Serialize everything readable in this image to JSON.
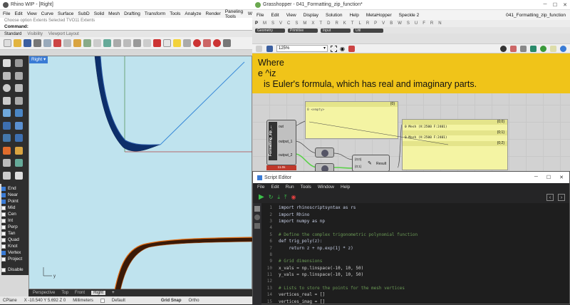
{
  "rhino": {
    "title": "Rhino WIP - [Right]",
    "menu": [
      "File",
      "Edit",
      "View",
      "Curve",
      "Surface",
      "SubD",
      "Solid",
      "Mesh",
      "Drafting",
      "Transform",
      "Tools",
      "Analyze",
      "Render",
      "Paneling Tools",
      "W"
    ],
    "cmd_history": "Choose option  Extents  Selected  TVO11  Extents",
    "command_label": "Command:",
    "toolbar_tabs": [
      "Standard",
      "Visibility",
      "Viewport Layout"
    ],
    "viewport_label": "Right",
    "viewport_tabs": [
      "Perspective",
      "Top",
      "Front",
      "Right"
    ],
    "osnaps": [
      {
        "label": "End",
        "on": true
      },
      {
        "label": "Near",
        "on": true
      },
      {
        "label": "Point",
        "on": true
      },
      {
        "label": "Mid",
        "on": false
      },
      {
        "label": "Cen",
        "on": false
      },
      {
        "label": "Int",
        "on": false
      },
      {
        "label": "Perp",
        "on": false
      },
      {
        "label": "Tan",
        "on": false
      },
      {
        "label": "Quad",
        "on": false
      },
      {
        "label": "Knot",
        "on": false
      },
      {
        "label": "Vertex",
        "on": true
      },
      {
        "label": "Project",
        "on": false
      },
      {
        "label": "Disable",
        "on": false
      }
    ],
    "status": {
      "cplane": "CPlane",
      "coords": "X -10.540 Y 5.692 Z 0",
      "units": "Millimeters",
      "layer": "Default",
      "grid_snap": "Grid Snap",
      "ortho": "Ortho"
    }
  },
  "grasshopper": {
    "title": "Grasshopper - 041_Formatting_zip_function*",
    "menu": [
      "File",
      "Edit",
      "View",
      "Display",
      "Solution",
      "Help",
      "MetaHopper",
      "Speckle 2"
    ],
    "doc_name": "041_Formatting_zip_function",
    "tab_letters": [
      "P",
      "M",
      "S",
      "V",
      "C",
      "S",
      "M",
      "X",
      "T",
      "D",
      "R",
      "K",
      "T",
      "L",
      "R",
      "P",
      "V",
      "B",
      "W",
      "S",
      "U",
      "F",
      "R",
      "N"
    ],
    "subtabs": [
      "Geometry",
      "Primitive",
      "Input",
      "Util"
    ],
    "zoom": "125%",
    "note_lines": [
      "Where",
      "e ^iz",
      "is Euler's formula, which has real and imaginary parts."
    ],
    "component_name": "Formatting_zip_...",
    "component_outputs": [
      "out",
      "output_1",
      "output_2"
    ],
    "component_time": "11.0s",
    "panel_main_header": "{0}",
    "panel_main_text": "0  <empty>",
    "mesh_panels": [
      {
        "header": "{0;0}",
        "text": "0 Mesh (V:2500  F:2401)"
      },
      {
        "header": "{0;1}",
        "text": "0 Mesh (V:2500  F:2401)"
      },
      {
        "header": "{0;2}",
        "text": ""
      }
    ],
    "data_rows": [
      "{0;0}",
      "{0;1}"
    ],
    "result_label": "Result"
  },
  "script_editor": {
    "title": "Script Editor",
    "menu": [
      "File",
      "Edit",
      "Run",
      "Tools",
      "Window",
      "Help"
    ],
    "lines": [
      {
        "n": "1",
        "t": "import rhinoscriptsyntax as rs",
        "k": "kw"
      },
      {
        "n": "2",
        "t": "import Rhino",
        "k": "kw"
      },
      {
        "n": "3",
        "t": "import numpy as np",
        "k": "kw"
      },
      {
        "n": "4",
        "t": "",
        "k": "pl"
      },
      {
        "n": "5",
        "t": "# Define the complex trigonometric polynomial function",
        "k": "cm"
      },
      {
        "n": "6",
        "t": "def trig_poly(z):",
        "k": "kw"
      },
      {
        "n": "7",
        "t": "    return z + np.exp(1j * z)",
        "k": "kw"
      },
      {
        "n": "8",
        "t": "",
        "k": "pl"
      },
      {
        "n": "9",
        "t": "# Grid dimensions",
        "k": "cm"
      },
      {
        "n": "10",
        "t": "x_vals = np.linspace(-10, 10, 50)",
        "k": "pl"
      },
      {
        "n": "11",
        "t": "y_vals = np.linspace(-10, 10, 50)",
        "k": "pl"
      },
      {
        "n": "12",
        "t": "",
        "k": "pl"
      },
      {
        "n": "13",
        "t": "# Lists to store the points for the mesh vertices",
        "k": "cm"
      },
      {
        "n": "14",
        "t": "vertices_real = []",
        "k": "pl"
      },
      {
        "n": "15",
        "t": "vertices_imag = []",
        "k": "pl"
      },
      {
        "n": "16",
        "t": "",
        "k": "pl"
      },
      {
        "n": "17",
        "t": "# Loop through the grid, evaluate the polynomial, and extract real and imaginary parts",
        "k": "cm"
      }
    ]
  },
  "colors": {
    "accent": "#3a7bd5",
    "note_bg": "#f0c419",
    "viewport_bg": "#bfe3ee",
    "code_bg": "#1e1e1e"
  }
}
